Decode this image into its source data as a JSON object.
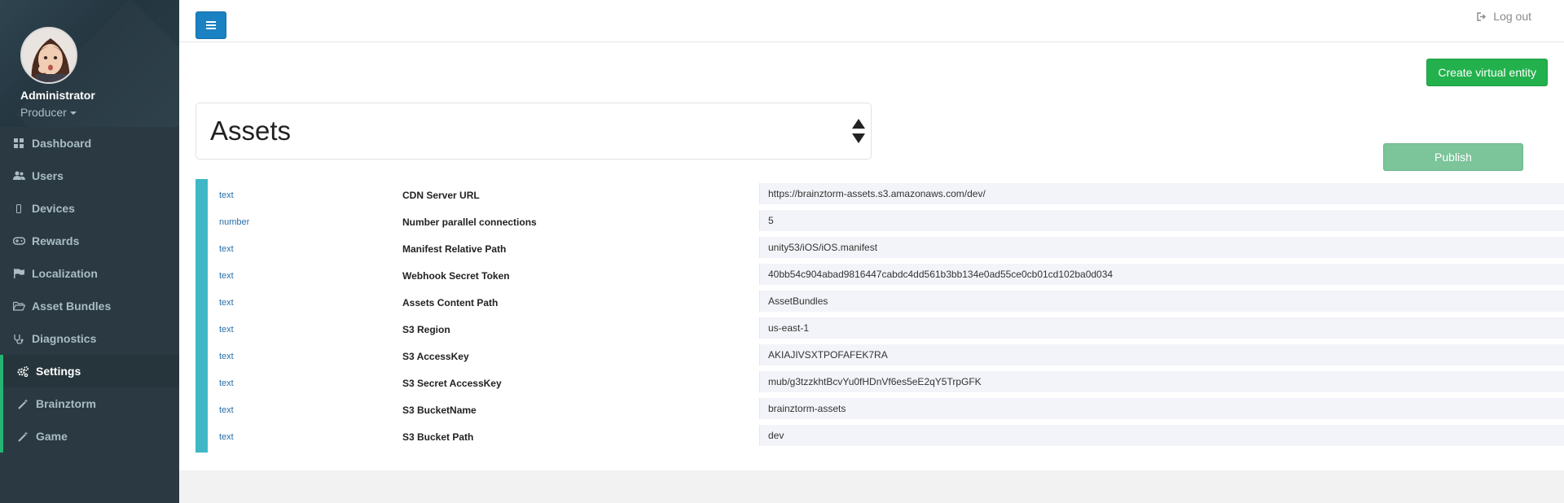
{
  "sidebar": {
    "profile": {
      "name": "Administrator",
      "role": "Producer"
    },
    "items": [
      {
        "label": "Dashboard",
        "icon": "dashboard-icon"
      },
      {
        "label": "Users",
        "icon": "users-icon"
      },
      {
        "label": "Devices",
        "icon": "mobile-icon"
      },
      {
        "label": "Rewards",
        "icon": "gamepad-icon"
      },
      {
        "label": "Localization",
        "icon": "flag-icon"
      },
      {
        "label": "Asset Bundles",
        "icon": "folder-open-icon"
      },
      {
        "label": "Diagnostics",
        "icon": "stethoscope-icon"
      },
      {
        "label": "Settings",
        "icon": "gears-icon"
      },
      {
        "label": "Brainztorm",
        "icon": "magic-wand-icon"
      },
      {
        "label": "Game",
        "icon": "magic-wand-icon"
      }
    ],
    "active_item": "Settings"
  },
  "topbar": {
    "logout_label": "Log out"
  },
  "toolbar": {
    "create_label": "Create virtual entity",
    "publish_label": "Publish"
  },
  "entity_select": {
    "selected": "Assets"
  },
  "settings": [
    {
      "type": "text",
      "label": "CDN Server URL",
      "value": "https://brainztorm-assets.s3.amazonaws.com/dev/"
    },
    {
      "type": "number",
      "label": "Number parallel connections",
      "value": "5"
    },
    {
      "type": "text",
      "label": "Manifest Relative Path",
      "value": "unity53/iOS/iOS.manifest"
    },
    {
      "type": "text",
      "label": "Webhook Secret Token",
      "value": "40bb54c904abad9816447cabdc4dd561b3bb134e0ad55ce0cb01cd102ba0d034"
    },
    {
      "type": "text",
      "label": "Assets Content Path",
      "value": "AssetBundles"
    },
    {
      "type": "text",
      "label": "S3 Region",
      "value": "us-east-1"
    },
    {
      "type": "text",
      "label": "S3 AccessKey",
      "value": "AKIAJIVSXTPOFAFEK7RA"
    },
    {
      "type": "text",
      "label": "S3 Secret AccessKey",
      "value": "mub/g3tzzkhtBcvYu0fHDnVf6es5eE2qY5TrpGFK"
    },
    {
      "type": "text",
      "label": "S3 BucketName",
      "value": "brainztorm-assets"
    },
    {
      "type": "text",
      "label": "S3 Bucket Path",
      "value": "dev"
    }
  ],
  "colors": {
    "sidebar_bg": "#2b3a42",
    "active_marker": "#22b573",
    "primary": "#1a81c2",
    "success": "#22b14c",
    "publish": "#7cc49a",
    "row_accent": "#3fb7c7"
  }
}
